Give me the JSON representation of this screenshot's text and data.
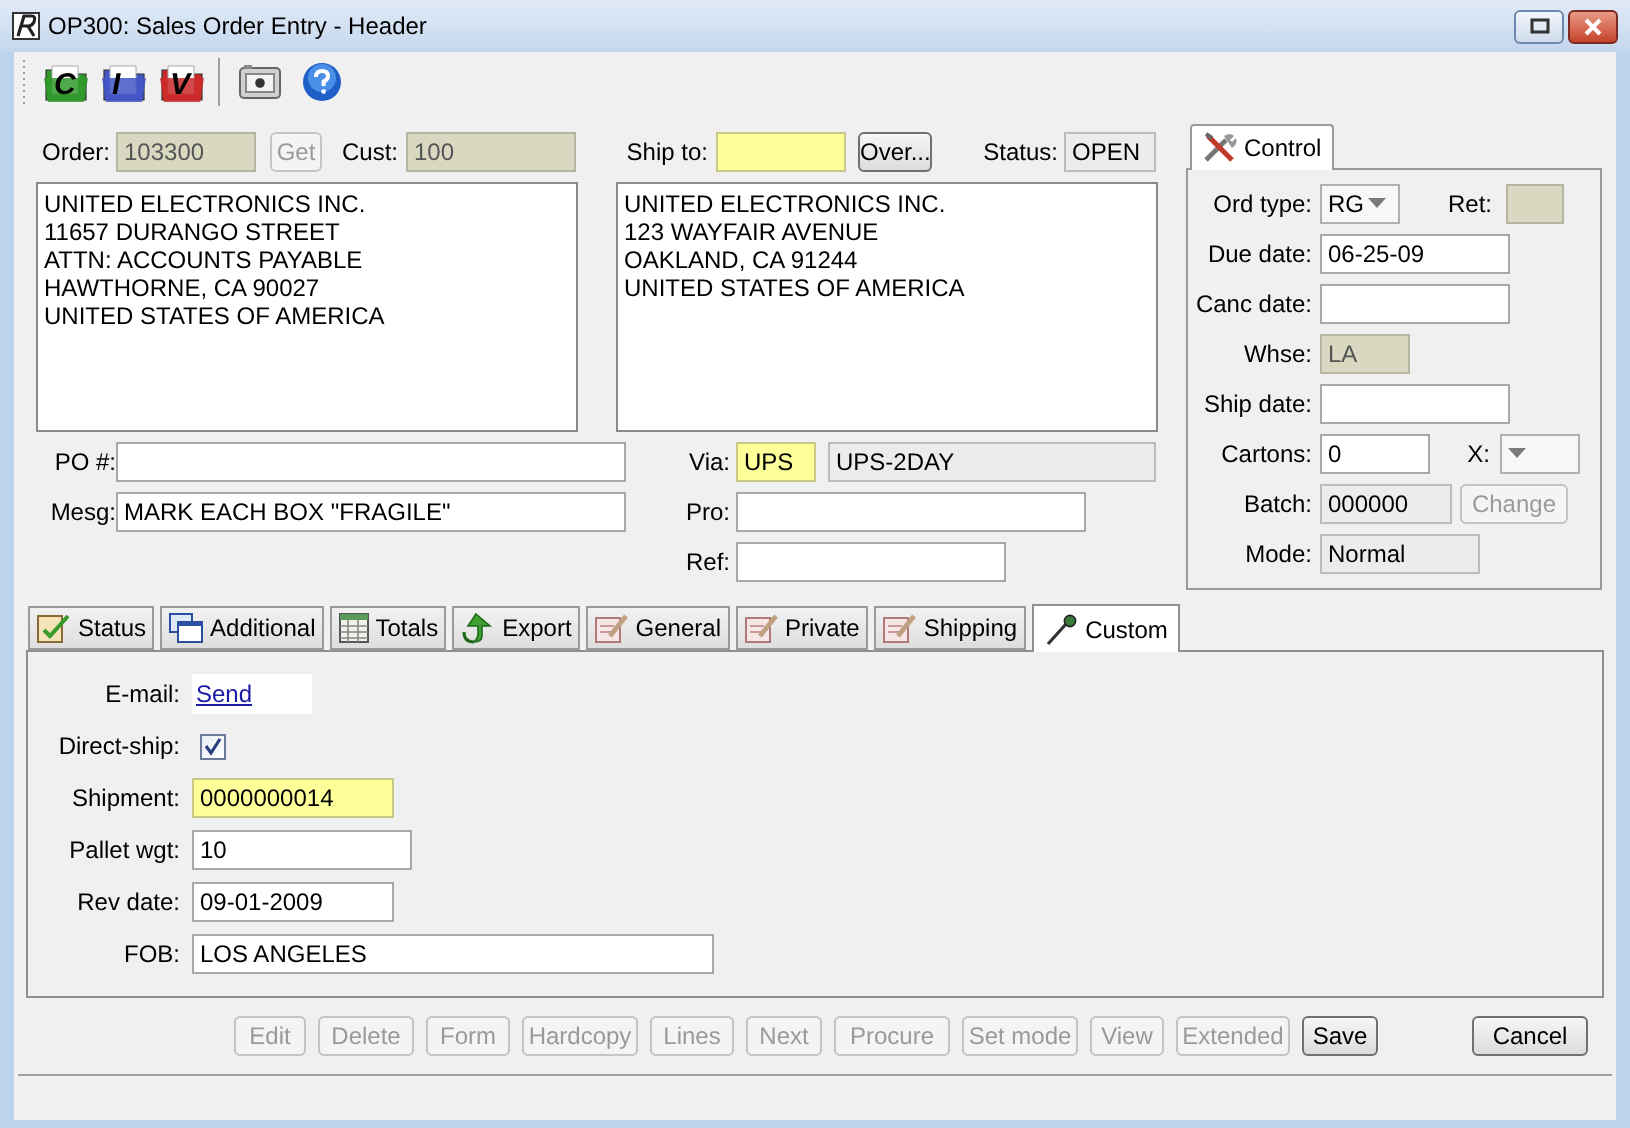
{
  "window": {
    "title": "OP300: Sales Order Entry - Header"
  },
  "toolbar": [
    {
      "kind": "folder",
      "letter": "C",
      "color": "#2f9a2a"
    },
    {
      "kind": "folder",
      "letter": "I",
      "color": "#4256c8"
    },
    {
      "kind": "folder",
      "letter": "V",
      "color": "#cc2a2a"
    },
    {
      "kind": "camera"
    },
    {
      "kind": "help"
    }
  ],
  "header": {
    "order": {
      "label": "Order:",
      "value": "103300",
      "locked": true
    },
    "get_button": {
      "label": "Get",
      "disabled": true
    },
    "cust": {
      "label": "Cust:",
      "value": "100",
      "locked": true
    },
    "ship_to": {
      "label": "Ship to:",
      "required": true
    },
    "over_button": {
      "label": "Over...",
      "disabled": false
    },
    "status": {
      "label": "Status:",
      "value": "OPEN",
      "read_only": true
    }
  },
  "bill_to_address": [
    "UNITED ELECTRONICS INC.",
    "11657 DURANGO STREET",
    "ATTN: ACCOUNTS PAYABLE",
    "HAWTHORNE, CA 90027",
    "UNITED STATES OF AMERICA"
  ],
  "ship_to_address": [
    "UNITED ELECTRONICS INC.",
    "123 WAYFAIR AVENUE",
    "OAKLAND, CA 91244",
    "UNITED STATES OF AMERICA"
  ],
  "order_fields": [
    {
      "label": "PO #:"
    },
    {
      "label": "Mesg:",
      "value": "MARK EACH BOX \"FRAGILE\""
    }
  ],
  "shipping_fields": [
    {
      "label": "Via:",
      "value": "UPS",
      "required": true,
      "description": "UPS-2DAY"
    },
    {
      "label": "Pro:"
    },
    {
      "label": "Ref:"
    }
  ],
  "control_panel": {
    "tab": "Control",
    "rows": [
      {
        "controls": [
          {
            "kind": "combo",
            "label": "Ord type:",
            "value": "RG"
          },
          {
            "kind": "text",
            "label": "Ret:",
            "locked": true
          }
        ]
      },
      {
        "controls": [
          {
            "kind": "text",
            "label": "Due date:",
            "value": "06-25-09"
          }
        ]
      },
      {
        "controls": [
          {
            "kind": "text",
            "label": "Canc date:"
          }
        ]
      },
      {
        "controls": [
          {
            "kind": "text",
            "label": "Whse:",
            "value": "LA",
            "locked": true
          }
        ]
      },
      {
        "controls": [
          {
            "kind": "text",
            "label": "Ship date:"
          }
        ]
      },
      {
        "controls": [
          {
            "kind": "text",
            "label": "Cartons:",
            "value": "0"
          },
          {
            "kind": "combo",
            "label": "X:"
          }
        ]
      },
      {
        "controls": [
          {
            "kind": "text",
            "label": "Batch:",
            "value": "000000",
            "read_only": true
          },
          {
            "kind": "button",
            "value": "Change",
            "disabled": true
          }
        ]
      },
      {
        "controls": [
          {
            "kind": "text",
            "label": "Mode:",
            "value": "Normal",
            "read_only": true
          }
        ]
      }
    ]
  },
  "tabs": [
    {
      "label": "Status",
      "kind": "status",
      "selected": false
    },
    {
      "label": "Additional",
      "kind": "windows",
      "selected": false
    },
    {
      "label": "Totals",
      "kind": "grid",
      "selected": false
    },
    {
      "label": "Export",
      "kind": "arrow",
      "selected": false
    },
    {
      "label": "General",
      "kind": "note",
      "selected": false
    },
    {
      "label": "Private",
      "kind": "note",
      "selected": false
    },
    {
      "label": "Shipping",
      "kind": "note",
      "selected": false
    },
    {
      "label": "Custom",
      "kind": "pin",
      "selected": true
    }
  ],
  "custom_fields": [
    {
      "kind": "link",
      "label": "E-mail:",
      "value": "Send"
    },
    {
      "kind": "checkbox",
      "label": "Direct-ship:",
      "checked": true
    },
    {
      "kind": "text",
      "label": "Shipment:",
      "value": "0000000014",
      "required": true
    },
    {
      "kind": "text",
      "label": "Pallet wgt:",
      "value": "10"
    },
    {
      "kind": "text",
      "label": "Rev date:",
      "value": "09-01-2009"
    },
    {
      "kind": "text",
      "label": "FOB:",
      "value": "LOS ANGELES"
    }
  ],
  "buttons": [
    {
      "label": "Edit",
      "disabled": true
    },
    {
      "label": "Delete",
      "disabled": true
    },
    {
      "label": "Form",
      "disabled": true
    },
    {
      "label": "Hardcopy",
      "disabled": true
    },
    {
      "label": "Lines",
      "disabled": true
    },
    {
      "label": "Next",
      "disabled": true
    },
    {
      "label": "Procure",
      "disabled": true
    },
    {
      "label": "Set mode",
      "disabled": true
    },
    {
      "label": "View",
      "disabled": true
    },
    {
      "label": "Extended",
      "disabled": true
    },
    {
      "label": "Save",
      "disabled": false
    }
  ],
  "cancel_button": {
    "label": "Cancel",
    "disabled": false
  }
}
